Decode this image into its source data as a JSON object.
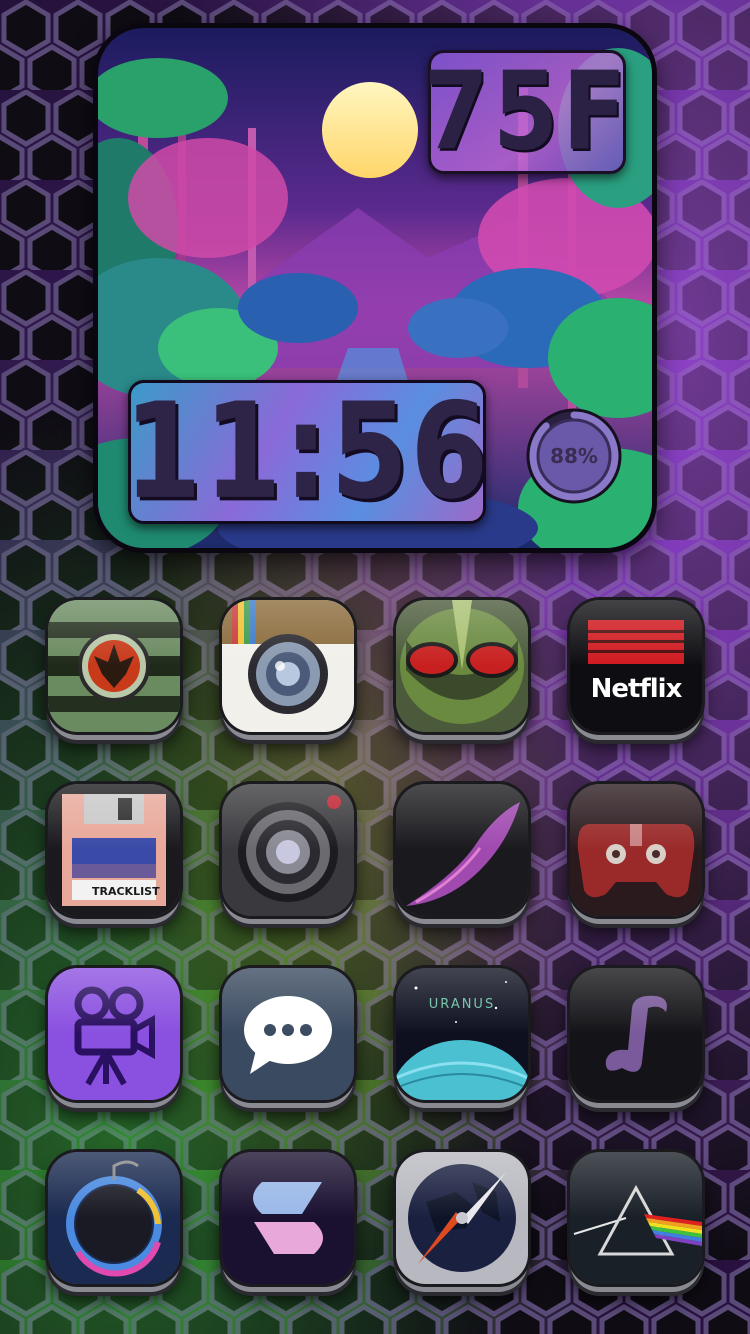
{
  "widget": {
    "temperature": "75F",
    "time": "11:56",
    "battery_percent": 88,
    "battery_label": "88%"
  },
  "apps": {
    "row1": [
      {
        "icon": "rebel-alliance-icon"
      },
      {
        "icon": "camera-icon"
      },
      {
        "icon": "alien-face-icon"
      },
      {
        "icon": "netflix-icon",
        "label": "Netflix"
      }
    ],
    "row2": [
      {
        "icon": "floppy-disk-icon",
        "label": "TRACKLIST"
      },
      {
        "icon": "camera-lens-icon"
      },
      {
        "icon": "swoosh-icon"
      },
      {
        "icon": "game-controller-icon"
      }
    ],
    "row3": [
      {
        "icon": "video-camera-icon"
      },
      {
        "icon": "messages-icon"
      },
      {
        "icon": "uranus-icon",
        "label": "URANUS"
      },
      {
        "icon": "music-note-icon"
      }
    ],
    "row4": [
      {
        "icon": "bomb-icon"
      },
      {
        "icon": "shazam-icon"
      },
      {
        "icon": "compass-icon"
      },
      {
        "icon": "prism-icon"
      }
    ]
  },
  "colors": {
    "accent_purple": "#8a3cff",
    "accent_green": "#3db04a",
    "netflix_red": "#c8141e"
  }
}
